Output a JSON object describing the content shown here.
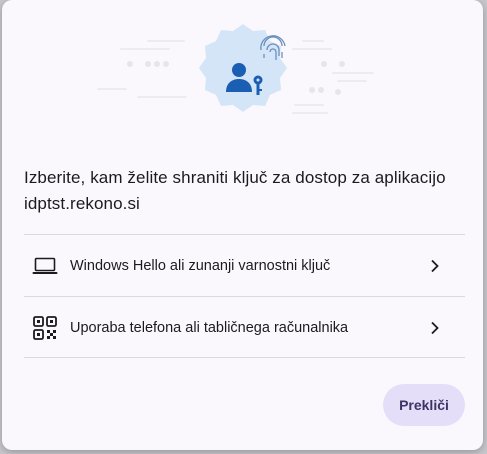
{
  "dialog": {
    "title": "Izberite, kam želite shraniti ključ za dostop za aplikacijo idptst.rekono.si",
    "options": [
      {
        "label": "Windows Hello ali zunanji varnostni ključ",
        "icon": "laptop-icon"
      },
      {
        "label": "Uporaba telefona ali tabličnega računalnika",
        "icon": "qr-code-icon"
      }
    ],
    "cancel_label": "Prekliči"
  },
  "colors": {
    "accent": "#1a5fb4",
    "badge": "#d4e5f8",
    "cancel_bg": "#e4def8"
  }
}
